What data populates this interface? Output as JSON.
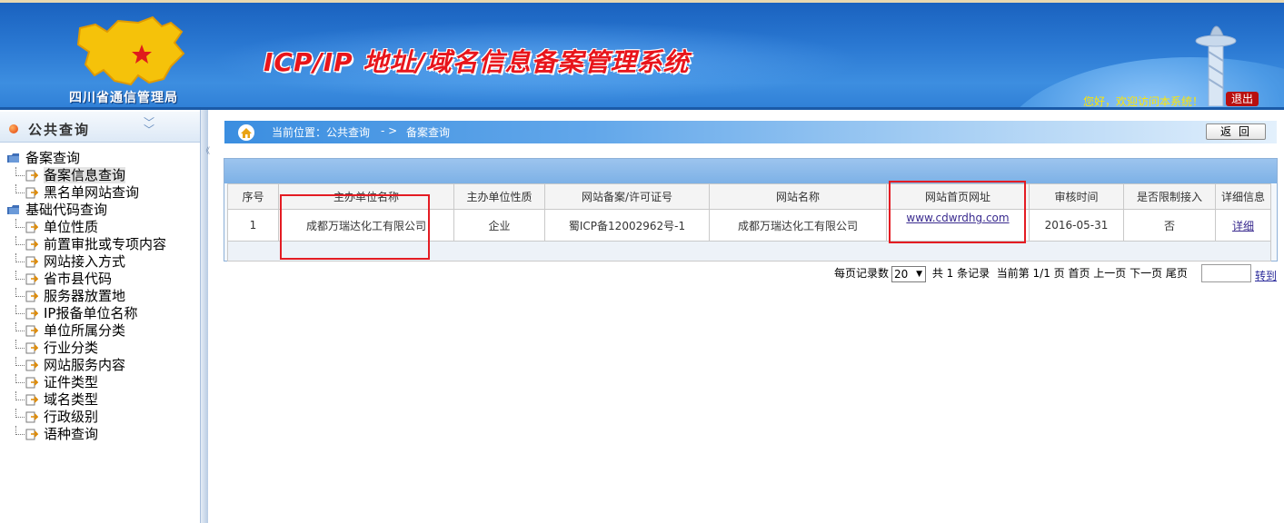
{
  "header": {
    "logo_text": "四川省通信管理局",
    "system_title": "ICP/IP 地址/域名信息备案管理系统",
    "welcome": "您好，欢迎访问本系统！",
    "logout": "退出"
  },
  "sidebar": {
    "title": "公共查询",
    "groups": [
      {
        "label": "备案查询",
        "items": [
          "备案信息查询",
          "黑名单网站查询"
        ]
      },
      {
        "label": "基础代码查询",
        "items": [
          "单位性质",
          "前置审批或专项内容",
          "网站接入方式",
          "省市县代码",
          "服务器放置地",
          "IP报备单位名称",
          "单位所属分类",
          "行业分类",
          "网站服务内容",
          "证件类型",
          "域名类型",
          "行政级别",
          "语种查询"
        ]
      }
    ],
    "active_item": "备案信息查询"
  },
  "breadcrumb": {
    "prefix": "当前位置：公共查询",
    "arrow": "- >",
    "current": "备案查询",
    "back_button": "返回"
  },
  "table": {
    "columns": [
      "序号",
      "主办单位名称",
      "主办单位性质",
      "网站备案/许可证号",
      "网站名称",
      "网站首页网址",
      "审核时间",
      "是否限制接入",
      "详细信息"
    ],
    "rows": [
      [
        "1",
        "成都万瑞达化工有限公司",
        "企业",
        "蜀ICP备12002962号-1",
        "成都万瑞达化工有限公司",
        "www.cdwrdhg.com",
        "2016-05-31",
        "否",
        "详细"
      ]
    ]
  },
  "pager": {
    "per_page_label": "每页记录数",
    "per_page_value": "20",
    "summary": "共 1 条记录  当前第 1/1 页 首页 上一页 下一页 尾页",
    "goto_label": "转到"
  },
  "colors": {
    "header_blue": "#2a78d2",
    "title_red": "#e8151b",
    "highlight_red": "#e41c23",
    "link_purple": "#3a2b8f"
  }
}
